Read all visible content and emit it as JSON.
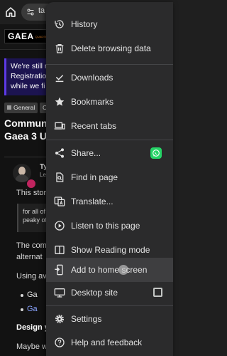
{
  "toolbar": {
    "address_text": "ta"
  },
  "page": {
    "logo_text": "GAEA",
    "logo_subtext": "QUADSPINNER",
    "banner_lines": [
      "We're still r",
      "Registration",
      "while we fi"
    ],
    "tags": [
      "General",
      "C"
    ],
    "title_lines": [
      "Commun",
      "Gaea 3 U"
    ],
    "user_name": "Ty",
    "user_sub": "Le",
    "intro": "This stor",
    "quote_lines": [
      "for all of",
      "peaky of"
    ],
    "para2_lines": [
      "The com",
      "alternat"
    ],
    "para3": "Using av",
    "bullets": [
      "Ga",
      "Ga"
    ],
    "heading": "Design y",
    "para4": "Maybe w"
  },
  "menu": {
    "items": {
      "history": "History",
      "delete_browsing_data": "Delete browsing data",
      "downloads": "Downloads",
      "bookmarks": "Bookmarks",
      "recent_tabs": "Recent tabs",
      "share": "Share...",
      "find_in_page": "Find in page",
      "translate": "Translate...",
      "listen": "Listen to this page",
      "reading_mode": "Show Reading mode",
      "add_to_home": "Add to home screen",
      "desktop_site": "Desktop site",
      "settings": "Settings",
      "help": "Help and feedback"
    },
    "desktop_site_checked": false,
    "highlighted_item": "add_to_home",
    "colors": {
      "menu_bg": "#2b2b2c",
      "highlight_bg": "#3e3e40",
      "whatsapp": "#25d366",
      "banner_bg": "#1c1450"
    }
  }
}
